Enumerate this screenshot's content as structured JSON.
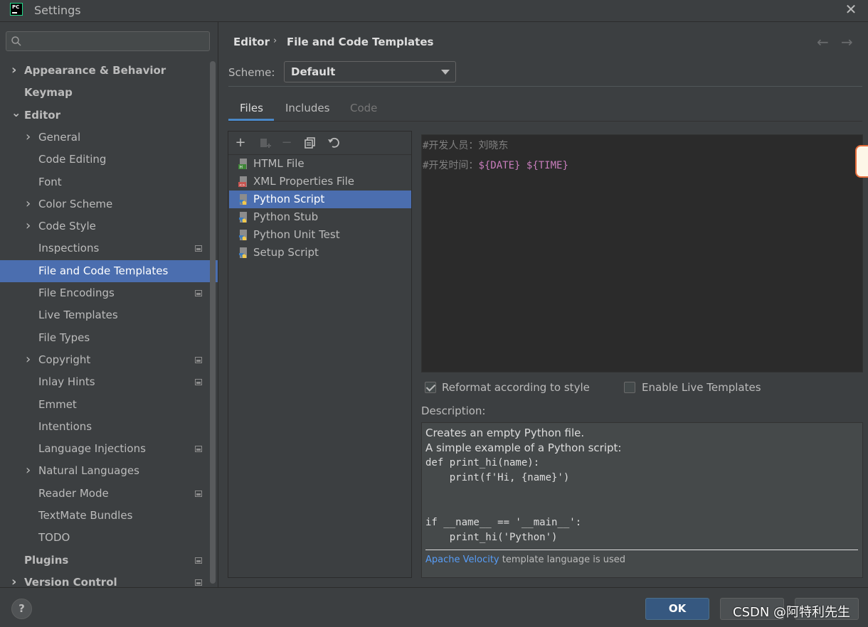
{
  "window": {
    "title": "Settings"
  },
  "search": {
    "value": ""
  },
  "sidebar": {
    "items": [
      {
        "label": "Appearance & Behavior",
        "level": 0,
        "expandable": true,
        "expanded": false,
        "bold": true
      },
      {
        "label": "Keymap",
        "level": 0,
        "expandable": false,
        "bold": true
      },
      {
        "label": "Editor",
        "level": 0,
        "expandable": true,
        "expanded": true,
        "bold": true
      },
      {
        "label": "General",
        "level": 1,
        "expandable": true,
        "expanded": false
      },
      {
        "label": "Code Editing",
        "level": 1
      },
      {
        "label": "Font",
        "level": 1
      },
      {
        "label": "Color Scheme",
        "level": 1,
        "expandable": true,
        "expanded": false
      },
      {
        "label": "Code Style",
        "level": 1,
        "expandable": true,
        "expanded": false
      },
      {
        "label": "Inspections",
        "level": 1,
        "project": true
      },
      {
        "label": "File and Code Templates",
        "level": 1,
        "selected": true
      },
      {
        "label": "File Encodings",
        "level": 1,
        "project": true
      },
      {
        "label": "Live Templates",
        "level": 1
      },
      {
        "label": "File Types",
        "level": 1
      },
      {
        "label": "Copyright",
        "level": 1,
        "expandable": true,
        "expanded": false,
        "project": true
      },
      {
        "label": "Inlay Hints",
        "level": 1,
        "project": true
      },
      {
        "label": "Emmet",
        "level": 1
      },
      {
        "label": "Intentions",
        "level": 1
      },
      {
        "label": "Language Injections",
        "level": 1,
        "project": true
      },
      {
        "label": "Natural Languages",
        "level": 1,
        "expandable": true,
        "expanded": false
      },
      {
        "label": "Reader Mode",
        "level": 1,
        "project": true
      },
      {
        "label": "TextMate Bundles",
        "level": 1
      },
      {
        "label": "TODO",
        "level": 1
      },
      {
        "label": "Plugins",
        "level": 0,
        "bold": true,
        "project": true
      },
      {
        "label": "Version Control",
        "level": 0,
        "expandable": true,
        "expanded": false,
        "bold": true,
        "project": true
      }
    ]
  },
  "breadcrumb": {
    "parent": "Editor",
    "separator": "›",
    "current": "File and Code Templates"
  },
  "scheme": {
    "label": "Scheme:",
    "value": "Default"
  },
  "tabs": [
    {
      "label": "Files",
      "active": true
    },
    {
      "label": "Includes",
      "active": false
    },
    {
      "label": "Code",
      "disabled": true
    }
  ],
  "templates": {
    "items": [
      {
        "label": "HTML File",
        "icon": "html-file-icon"
      },
      {
        "label": "XML Properties File",
        "icon": "xml-file-icon"
      },
      {
        "label": "Python Script",
        "icon": "python-file-icon",
        "selected": true
      },
      {
        "label": "Python Stub",
        "icon": "python-file-icon"
      },
      {
        "label": "Python Unit Test",
        "icon": "python-file-icon"
      },
      {
        "label": "Setup Script",
        "icon": "python-file-icon"
      }
    ]
  },
  "editor": {
    "line1": "#开发人员：刘晓东",
    "line2_prefix": "#开发时间：",
    "line2_var1": "${DATE}",
    "line2_var2": "${TIME}"
  },
  "options": {
    "reformat": {
      "label": "Reformat according to style",
      "checked": true
    },
    "live_templates": {
      "label": "Enable Live Templates",
      "checked": false
    }
  },
  "description": {
    "label": "Description:",
    "lines": [
      "Creates an empty Python file.",
      "A simple example of a Python script:"
    ],
    "code": [
      "def print_hi(name):",
      "    print(f'Hi, {name}')",
      "",
      "",
      "if __name__ == '__main__':",
      "    print_hi('Python')"
    ],
    "footer_link": "Apache Velocity",
    "footer_text": " template language is used"
  },
  "buttons": {
    "help": "?",
    "ok": "OK"
  },
  "watermark": "CSDN @阿特利先生",
  "colors": {
    "selection": "#4b6eaf",
    "background": "#3c3f41",
    "editor": "#2b2b2b",
    "accent": "#4a88c7"
  }
}
